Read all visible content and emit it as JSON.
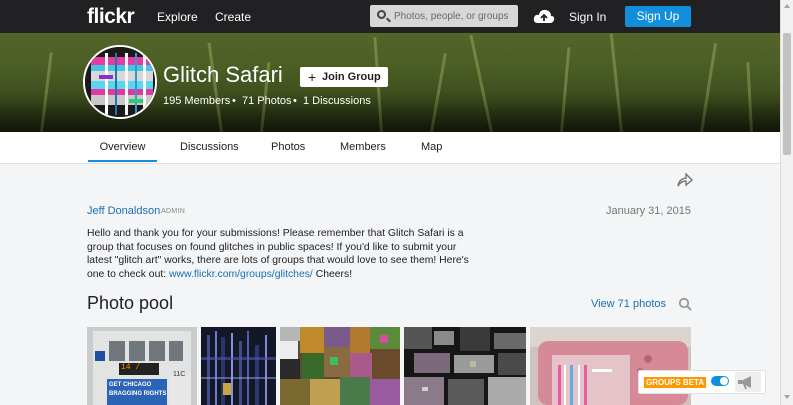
{
  "topnav": {
    "logo": "flickr",
    "explore": "Explore",
    "create": "Create",
    "search_placeholder": "Photos, people, or groups",
    "sign_in": "Sign In",
    "sign_up": "Sign Up"
  },
  "group": {
    "title": "Glitch Safari",
    "join_label": "Join Group",
    "members": "195 Members",
    "photos": "71 Photos",
    "discussions": "1 Discussions",
    "separator": "•"
  },
  "tabs": [
    "Overview",
    "Discussions",
    "Photos",
    "Members",
    "Map"
  ],
  "post": {
    "author": "Jeff Donaldson",
    "role": "ADMIN",
    "date": "January 31, 2015",
    "text_before_link": "Hello and thank you for your submissions! Please remember that Glitch Safari is a group that focuses on found glitches in public spaces! If you'd like to submit your latest \"glitch art\" works, there are lots of groups that would love to see them! Here's one to check out: ",
    "link": "www.flickr.com/groups/glitches/",
    "text_after_link": " Cheers!"
  },
  "photo_pool": {
    "title": "Photo pool",
    "view_link": "View 71 photos",
    "thumb_texts": {
      "bus_line1": "GET CHICAGO",
      "bus_line2": "BRAGGING RIGHTS",
      "bus_number": "11C"
    }
  },
  "groups_beta": {
    "label": "GROUPS BETA",
    "enabled": true
  },
  "colors": {
    "accent": "#128fdc",
    "link": "#1a6fb5",
    "nav_bg": "#212124",
    "beta_badge": "#ff9800"
  }
}
